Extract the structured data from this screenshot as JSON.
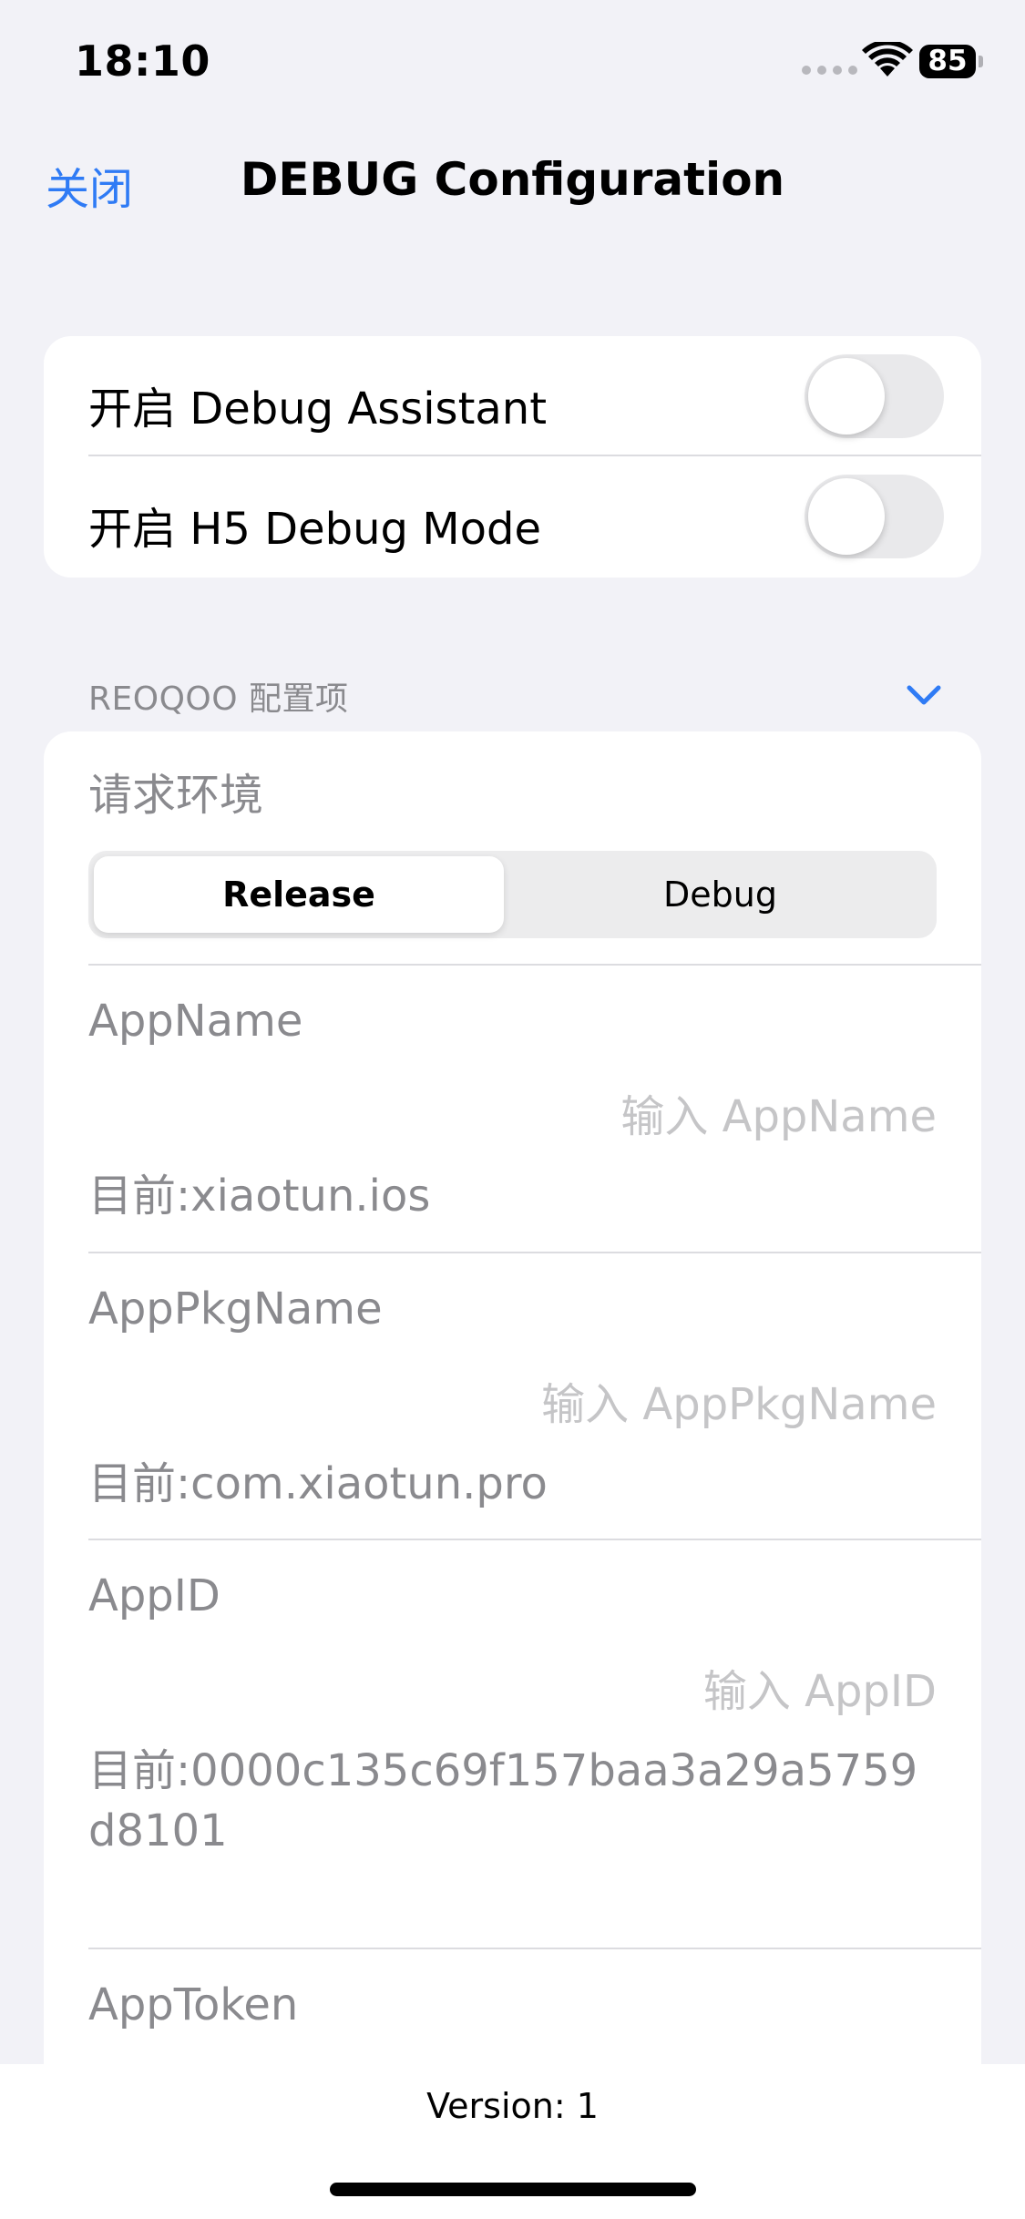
{
  "status_bar": {
    "time": "18:10",
    "battery": "85"
  },
  "nav": {
    "close_label": "关闭",
    "title": "DEBUG Configuration"
  },
  "toggles": [
    {
      "label": "开启 Debug Assistant",
      "on": false
    },
    {
      "label": "开启 H5 Debug Mode",
      "on": false
    }
  ],
  "section": {
    "header": "REOQOO 配置项"
  },
  "environment": {
    "label": "请求环境",
    "options": [
      "Release",
      "Debug"
    ],
    "selected": "Release"
  },
  "fields": [
    {
      "label": "AppName",
      "placeholder": "输入 AppName",
      "current": "目前:xiaotun.ios"
    },
    {
      "label": "AppPkgName",
      "placeholder": "输入 AppPkgName",
      "current": "目前:com.xiaotun.pro"
    },
    {
      "label": "AppID",
      "placeholder": "输入 AppID",
      "current": "目前:0000c135c69f157baa3a29a5759d8101"
    },
    {
      "label": "AppToken"
    }
  ],
  "footer": {
    "version": "Version: 1"
  }
}
